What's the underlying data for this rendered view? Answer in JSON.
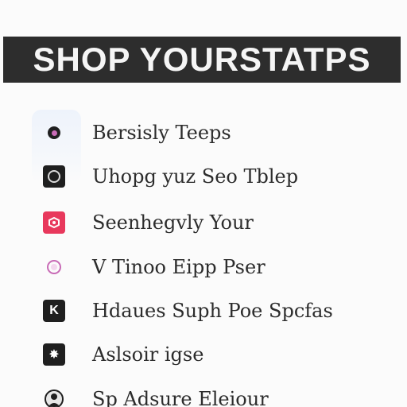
{
  "header": {
    "title": "SHOP YOURSTATPS"
  },
  "menu": {
    "items": [
      {
        "label": "Bersisly Teeps",
        "icon": "dot-icon"
      },
      {
        "label": "Uhopg yuz Seo Tblep",
        "icon": "camera-icon"
      },
      {
        "label": "Seenhegvly Your",
        "icon": "tag-icon"
      },
      {
        "label": "V Tinoo Eipp Pser",
        "icon": "circle-icon"
      },
      {
        "label": "Hdaues Suph Poe Spcfas",
        "icon": "k-icon"
      },
      {
        "label": "Aslsoir igse",
        "icon": "star-icon"
      },
      {
        "label": "Sp Adsure Eleiour",
        "icon": "avatar-icon"
      }
    ]
  },
  "colors": {
    "banner_bg": "#2d2d2d",
    "banner_text": "#f5f5f5",
    "accent_pink": "#e8385c",
    "accent_purple": "#c86bb6"
  }
}
